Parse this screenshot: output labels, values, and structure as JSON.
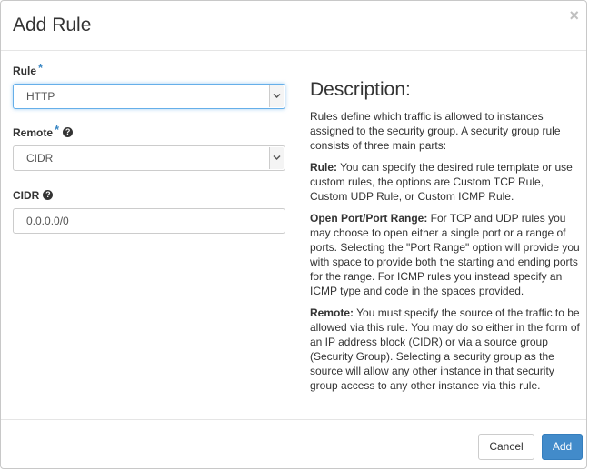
{
  "modal": {
    "title": "Add Rule",
    "close_symbol": "×"
  },
  "form": {
    "rule": {
      "label": "Rule",
      "required_mark": "*",
      "value": "HTTP"
    },
    "remote": {
      "label": "Remote",
      "required_mark": "*",
      "help_symbol": "?",
      "value": "CIDR"
    },
    "cidr": {
      "label": "CIDR",
      "help_symbol": "?",
      "value": "0.0.0.0/0"
    }
  },
  "description": {
    "heading": "Description:",
    "intro": "Rules define which traffic is allowed to instances assigned to the security group. A security group rule consists of three main parts:",
    "rule_title": "Rule:",
    "rule_text": " You can specify the desired rule template or use custom rules, the options are Custom TCP Rule, Custom UDP Rule, or Custom ICMP Rule.",
    "port_title": "Open Port/Port Range:",
    "port_text": " For TCP and UDP rules you may choose to open either a single port or a range of ports. Selecting the \"Port Range\" option will provide you with space to provide both the starting and ending ports for the range. For ICMP rules you instead specify an ICMP type and code in the spaces provided.",
    "remote_title": "Remote:",
    "remote_text": " You must specify the source of the traffic to be allowed via this rule. You may do so either in the form of an IP address block (CIDR) or via a source group (Security Group). Selecting a security group as the source will allow any other instance in that security group access to any other instance via this rule."
  },
  "footer": {
    "cancel_label": "Cancel",
    "add_label": "Add"
  },
  "colors": {
    "primary": "#428bca",
    "required": "#3a87c4",
    "focus": "#66afe9"
  }
}
